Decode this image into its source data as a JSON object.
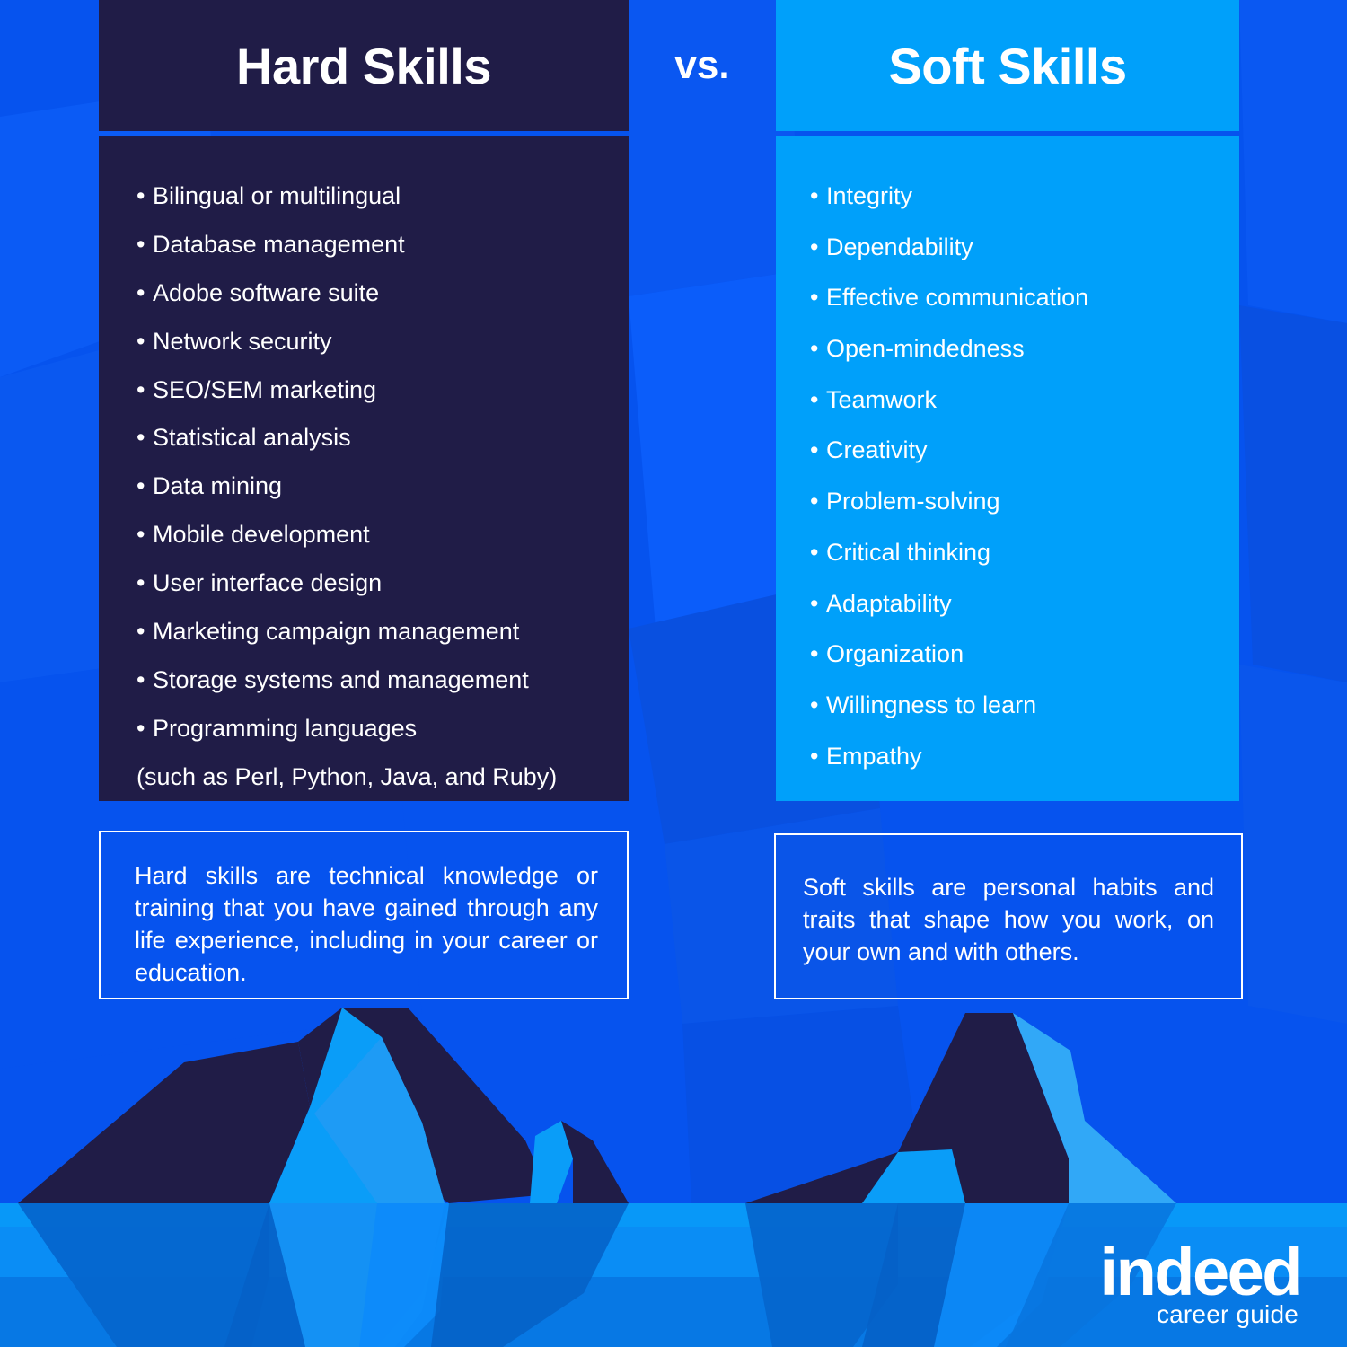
{
  "theme": {
    "background_blue": "#0653EE",
    "dark_panel": "#201C47",
    "light_blue_panel": "#00A0FA",
    "text_white": "#FFFFFF",
    "water_light": "#00A0FA",
    "water_mid": "#0089F5",
    "water_deep": "#0571DC"
  },
  "header": {
    "hard_title": "Hard Skills",
    "vs_label": "vs.",
    "soft_title": "Soft Skills"
  },
  "hard_skills": {
    "items": [
      "Bilingual or multilingual",
      "Database management",
      "Adobe software suite",
      "Network security",
      "SEO/SEM marketing",
      "Statistical analysis",
      "Data mining",
      "Mobile development",
      "User interface design",
      "Marketing campaign management",
      "Storage systems and management",
      "Programming languages"
    ],
    "note": "(such as Perl, Python, Java, and Ruby)",
    "bullet": "•"
  },
  "soft_skills": {
    "items": [
      "Integrity",
      "Dependability",
      "Effective communication",
      "Open-mindedness",
      "Teamwork",
      "Creativity",
      "Problem-solving",
      "Critical thinking",
      "Adaptability",
      "Organization",
      "Willingness to learn",
      "Empathy"
    ],
    "bullet": "•"
  },
  "definitions": {
    "hard": "Hard skills are technical knowledge or training that you have gained through any life experience, including in your career or education.",
    "soft": "Soft skills are personal habits and traits that shape how you work, on your own and with others."
  },
  "logo": {
    "wordmark": "indeed",
    "tagline": "career guide"
  }
}
